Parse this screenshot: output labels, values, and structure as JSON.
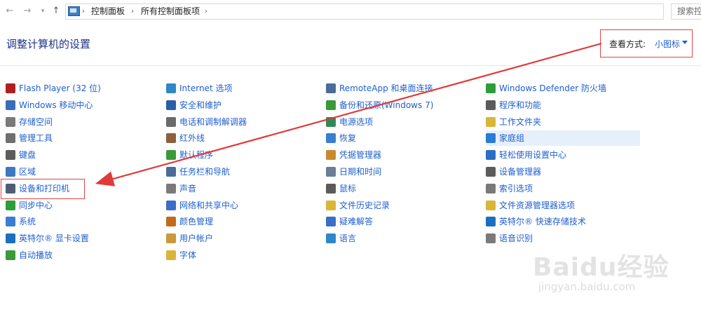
{
  "address_bar": {
    "breadcrumbs": [
      "控制面板",
      "所有控制面板项"
    ],
    "search_placeholder": "搜索控"
  },
  "header": {
    "title": "调整计算机的设置",
    "view_by_label": "查看方式:",
    "view_by_value": "小图标"
  },
  "columns": [
    [
      {
        "label": "Flash Player (32 位)",
        "icon": "flash-icon",
        "color": "#b21e1e"
      },
      {
        "label": "Windows 移动中心",
        "icon": "mobility-center-icon",
        "color": "#3b6cb7"
      },
      {
        "label": "存储空间",
        "icon": "storage-spaces-icon",
        "color": "#7a7a7a"
      },
      {
        "label": "管理工具",
        "icon": "admin-tools-icon",
        "color": "#6f6f6f"
      },
      {
        "label": "键盘",
        "icon": "keyboard-icon",
        "color": "#5b5b5b"
      },
      {
        "label": "区域",
        "icon": "region-icon",
        "color": "#3b79c4"
      },
      {
        "label": "设备和打印机",
        "icon": "devices-printers-icon",
        "color": "#4d5e74"
      },
      {
        "label": "同步中心",
        "icon": "sync-center-icon",
        "color": "#2e9d3b"
      },
      {
        "label": "系统",
        "icon": "system-icon",
        "color": "#3a7ed1"
      },
      {
        "label": "英特尔® 显卡设置",
        "icon": "intel-graphics-icon",
        "color": "#1b6fc2"
      },
      {
        "label": "自动播放",
        "icon": "autoplay-icon",
        "color": "#3a9a3a"
      }
    ],
    [
      {
        "label": "Internet 选项",
        "icon": "internet-options-icon",
        "color": "#2f86c9"
      },
      {
        "label": "安全和维护",
        "icon": "flag-icon",
        "color": "#2d5da6"
      },
      {
        "label": "电话和调制解调器",
        "icon": "phone-modem-icon",
        "color": "#6a6a6a"
      },
      {
        "label": "红外线",
        "icon": "infrared-icon",
        "color": "#8d5f3b"
      },
      {
        "label": "默认程序",
        "icon": "default-programs-icon",
        "color": "#3a9a3a"
      },
      {
        "label": "任务栏和导航",
        "icon": "taskbar-icon",
        "color": "#4a6c99"
      },
      {
        "label": "声音",
        "icon": "sound-icon",
        "color": "#7a7a7a"
      },
      {
        "label": "网络和共享中心",
        "icon": "network-icon",
        "color": "#3a6ec7"
      },
      {
        "label": "颜色管理",
        "icon": "color-management-icon",
        "color": "#c26a1b"
      },
      {
        "label": "用户帐户",
        "icon": "user-accounts-icon",
        "color": "#c99a3a"
      },
      {
        "label": "字体",
        "icon": "fonts-icon",
        "color": "#d9b53a"
      }
    ],
    [
      {
        "label": "RemoteApp 和桌面连接",
        "icon": "remoteapp-icon",
        "color": "#4a6c99"
      },
      {
        "label": "备份和还原(Windows 7)",
        "icon": "backup-icon",
        "color": "#3a9a3a"
      },
      {
        "label": "电源选项",
        "icon": "power-options-icon",
        "color": "#2e8b57"
      },
      {
        "label": "恢复",
        "icon": "recovery-icon",
        "color": "#3a7ed1"
      },
      {
        "label": "凭据管理器",
        "icon": "credential-manager-icon",
        "color": "#c98a2e"
      },
      {
        "label": "日期和时间",
        "icon": "date-time-icon",
        "color": "#6a7d99"
      },
      {
        "label": "鼠标",
        "icon": "mouse-icon",
        "color": "#5b5b5b"
      },
      {
        "label": "文件历史记录",
        "icon": "file-history-icon",
        "color": "#d9b53a"
      },
      {
        "label": "疑难解答",
        "icon": "troubleshooting-icon",
        "color": "#3a6ec7"
      },
      {
        "label": "语言",
        "icon": "language-icon",
        "color": "#2f86c9"
      }
    ],
    [
      {
        "label": "Windows Defender 防火墙",
        "icon": "firewall-icon",
        "color": "#2e9d3b"
      },
      {
        "label": "程序和功能",
        "icon": "programs-features-icon",
        "color": "#5b5b5b"
      },
      {
        "label": "工作文件夹",
        "icon": "work-folders-icon",
        "color": "#d9b53a"
      },
      {
        "label": "家庭组",
        "icon": "homegroup-icon",
        "color": "#2a7bd6"
      },
      {
        "label": "轻松使用设置中心",
        "icon": "ease-of-access-icon",
        "color": "#2a6fc7"
      },
      {
        "label": "设备管理器",
        "icon": "device-manager-icon",
        "color": "#5b5b5b"
      },
      {
        "label": "索引选项",
        "icon": "indexing-options-icon",
        "color": "#7a7a7a"
      },
      {
        "label": "文件资源管理器选项",
        "icon": "explorer-options-icon",
        "color": "#d9b53a"
      },
      {
        "label": "英特尔® 快速存储技术",
        "icon": "intel-rst-icon",
        "color": "#1b6fc2"
      },
      {
        "label": "语音识别",
        "icon": "speech-recognition-icon",
        "color": "#7a7a7a"
      }
    ]
  ],
  "watermark": {
    "logo": "Baidu经验",
    "url": "jingyan.baidu.com"
  }
}
